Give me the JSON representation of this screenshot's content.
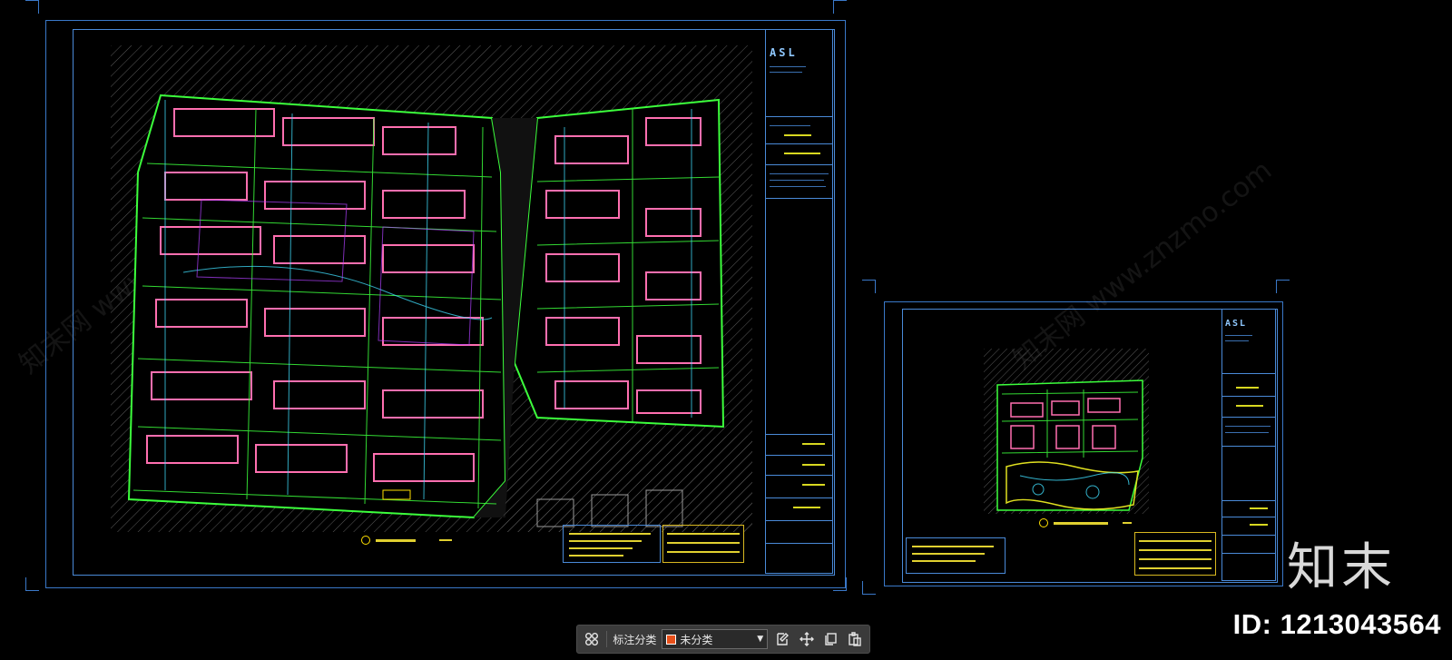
{
  "sheets": {
    "large": {
      "logo": "ASL"
    },
    "small": {
      "logo": "ASL"
    }
  },
  "watermarks": {
    "diagonal_text": "知末网 www.znzmo.com",
    "brand": "知末",
    "id_label": "ID: 1213043564"
  },
  "toolbar": {
    "layout_icon": "grid-icon",
    "category_label": "标注分类",
    "category_value": "未分类",
    "category_color": "#e8501a",
    "tools": [
      "edit-icon",
      "move-icon",
      "copy-icon",
      "paste-icon"
    ]
  },
  "colors": {
    "frame": "#3a78c8",
    "plan_green": "#3cff3c",
    "plan_pink": "#ff6fb0",
    "plan_cyan": "#40e0ff",
    "hatch": "#5a5a5a",
    "annotation_yellow": "#e0d030"
  }
}
